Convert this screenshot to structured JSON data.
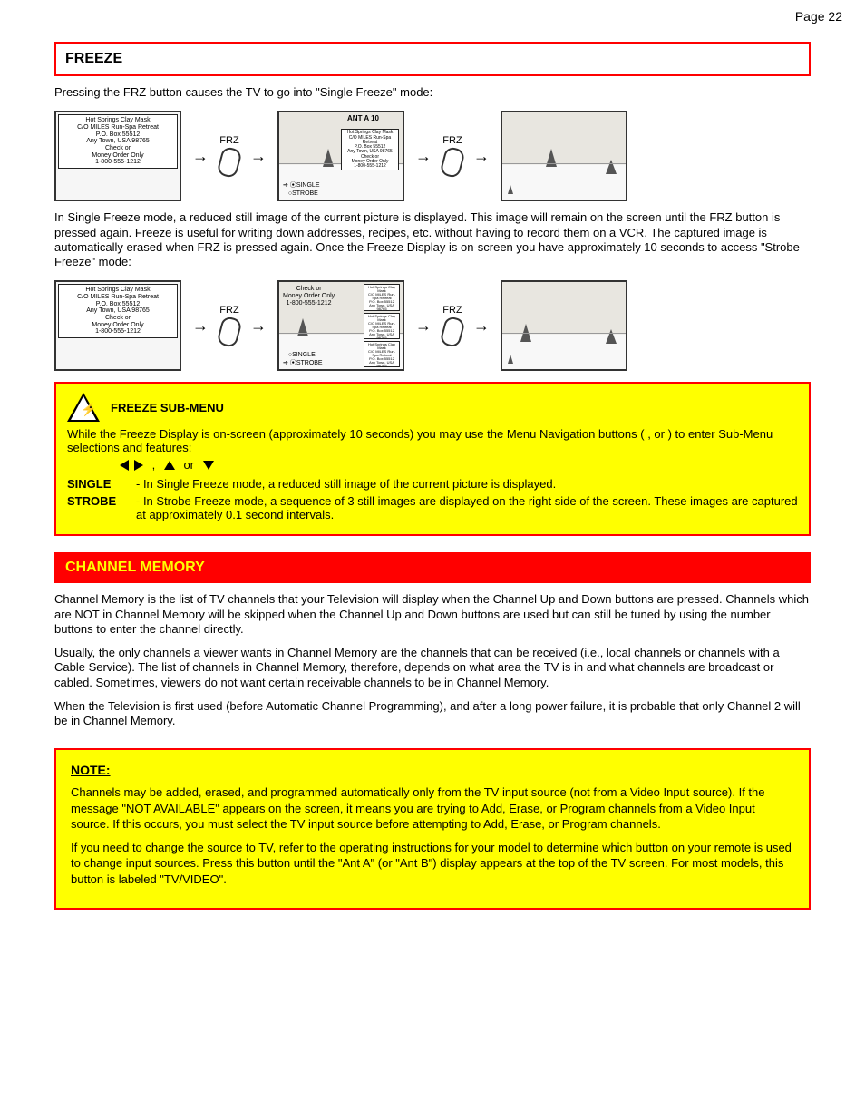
{
  "page_number_label": "Page",
  "page_number": "22",
  "section1_title": "FREEZE",
  "section1_intro": "Pressing the FRZ button causes the TV to go into \"Single Freeze\" mode:",
  "ad_text": "Hot Springs Clay Mask\nC/O MILES Run-Spa Retreat\nP.O. Box 55512\nAny Town, USA 98765\nCheck or\nMoney Order Only\n1-800-555-1212",
  "frz_label": "FRZ",
  "ant_label": "ANT A 10",
  "single_label": "SINGLE",
  "strobe_label": "STROBE",
  "section1_mid": "In Single Freeze mode, a reduced still image of the current picture is displayed. This image will remain on the screen until the FRZ button is pressed again. Freeze is useful for writing down addresses, recipes, etc. without having to record them on a VCR. The captured image is automatically erased when FRZ is pressed again. Once the Freeze Display is on-screen you have approximately 10 seconds to access \"Strobe Freeze\" mode:",
  "strobe_text_line1": "Check or",
  "strobe_text_line2": "Money Order Only",
  "strobe_text_line3": "1-800-555-1212",
  "warn_title": "FREEZE SUB-MENU",
  "warn_intro": "While the Freeze Display is on-screen (approximately 10 seconds) you may use the Menu Navigation buttons (   ,     or    ) to enter Sub-Menu selections and features:",
  "warn_step1_num": "SINGLE",
  "warn_step1_text": "- In Single Freeze mode, a reduced still image of the current picture is displayed.",
  "warn_step2_num": "STROBE",
  "warn_step2_text": "- In Strobe Freeze mode, a sequence of 3 still images are displayed on the right side of the screen. These images are captured at approximately 0.1 second intervals.",
  "section2_title": "CHANNEL MEMORY",
  "section2_body1": "Channel Memory is the list of TV channels that your Television will display when the Channel Up and Down buttons are pressed. Channels which are NOT in Channel Memory will be skipped when the Channel Up and Down buttons are used but can still be tuned by using the number buttons to enter the channel directly.",
  "section2_body2": "Usually, the only channels a viewer wants in Channel Memory are the channels that can be received (i.e., local channels or channels with a Cable Service). The list of channels in Channel Memory, therefore, depends on what area the TV is in and what channels are broadcast or cabled. Sometimes, viewers do not want certain receivable channels to be in Channel Memory.",
  "section2_body3": "When the Television is first used (before Automatic Channel Programming), and after a long power failure, it is probable that only Channel 2 will be in Channel Memory.",
  "note_title": "NOTE:",
  "note_p1": "Channels may be added, erased, and programmed automatically only from the TV input source (not from a Video Input source). If the message \"NOT AVAILABLE\" appears on the screen, it means you are trying to Add, Erase, or Program channels from a Video Input source. If this occurs, you must select the TV input source before attempting to Add, Erase, or Program channels.",
  "note_p2": "If you need to change the source to TV, refer to the operating instructions for your model to determine which button on your remote is used to change input sources. Press this button until the \"Ant A\" (or \"Ant B\") display appears at the top of the TV screen. For most models, this button is labeled \"TV/VIDEO\"."
}
